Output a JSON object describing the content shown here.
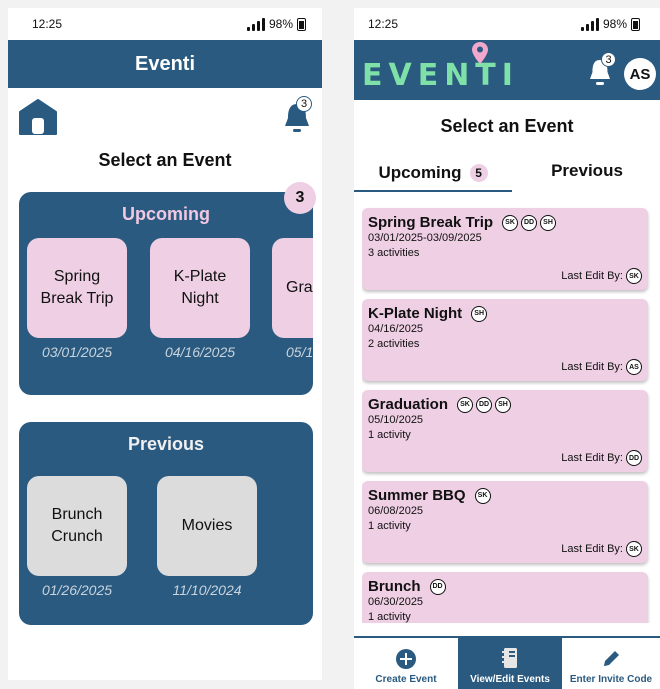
{
  "left": {
    "status": {
      "time": "12:25",
      "battery": "98%"
    },
    "header_title": "Eventi",
    "notif_count": "3",
    "select_title": "Select an Event",
    "upcoming": {
      "title": "Upcoming",
      "count": "3",
      "events": [
        {
          "name": "Spring Break Trip",
          "date": "03/01/2025"
        },
        {
          "name": "K-Plate Night",
          "date": "04/16/2025"
        },
        {
          "name": "Gra",
          "date": "05/1"
        }
      ]
    },
    "previous": {
      "title": "Previous",
      "events": [
        {
          "name": "Brunch Crunch",
          "date": "01/26/2025"
        },
        {
          "name": "Movies",
          "date": "11/10/2024"
        }
      ]
    }
  },
  "right": {
    "status": {
      "time": "12:25",
      "battery": "98%"
    },
    "logo_text": "EVENTI",
    "notif_count": "3",
    "avatar": "AS",
    "select_title": "Select an Event",
    "tabs": {
      "upcoming": "Upcoming",
      "upcoming_count": "5",
      "previous": "Previous"
    },
    "last_edit_label": "Last Edit By:",
    "events": [
      {
        "name": "Spring Break Trip",
        "members": [
          "SK",
          "DD",
          "SH"
        ],
        "dates": "03/01/2025-03/09/2025",
        "activities": "3 activities",
        "last_edit": "SK"
      },
      {
        "name": "K-Plate Night",
        "members": [
          "SH"
        ],
        "dates": "04/16/2025",
        "activities": "2 activities",
        "last_edit": "AS"
      },
      {
        "name": "Graduation",
        "members": [
          "SK",
          "DD",
          "SH"
        ],
        "dates": "05/10/2025",
        "activities": "1 activity",
        "last_edit": "DD"
      },
      {
        "name": "Summer BBQ",
        "members": [
          "SK"
        ],
        "dates": "06/08/2025",
        "activities": "1 activity",
        "last_edit": "SK"
      },
      {
        "name": "Brunch",
        "members": [
          "DD"
        ],
        "dates": "06/30/2025",
        "activities": "1 activity",
        "last_edit": ""
      }
    ],
    "nav": {
      "create": "Create Event",
      "view": "View/Edit Events",
      "code": "Enter Invite Code"
    }
  },
  "colors": {
    "primary": "#2a5a80",
    "pink": "#efcfe4",
    "grey_card": "#dcdcdc",
    "logo_green": "#7fe0a8"
  }
}
